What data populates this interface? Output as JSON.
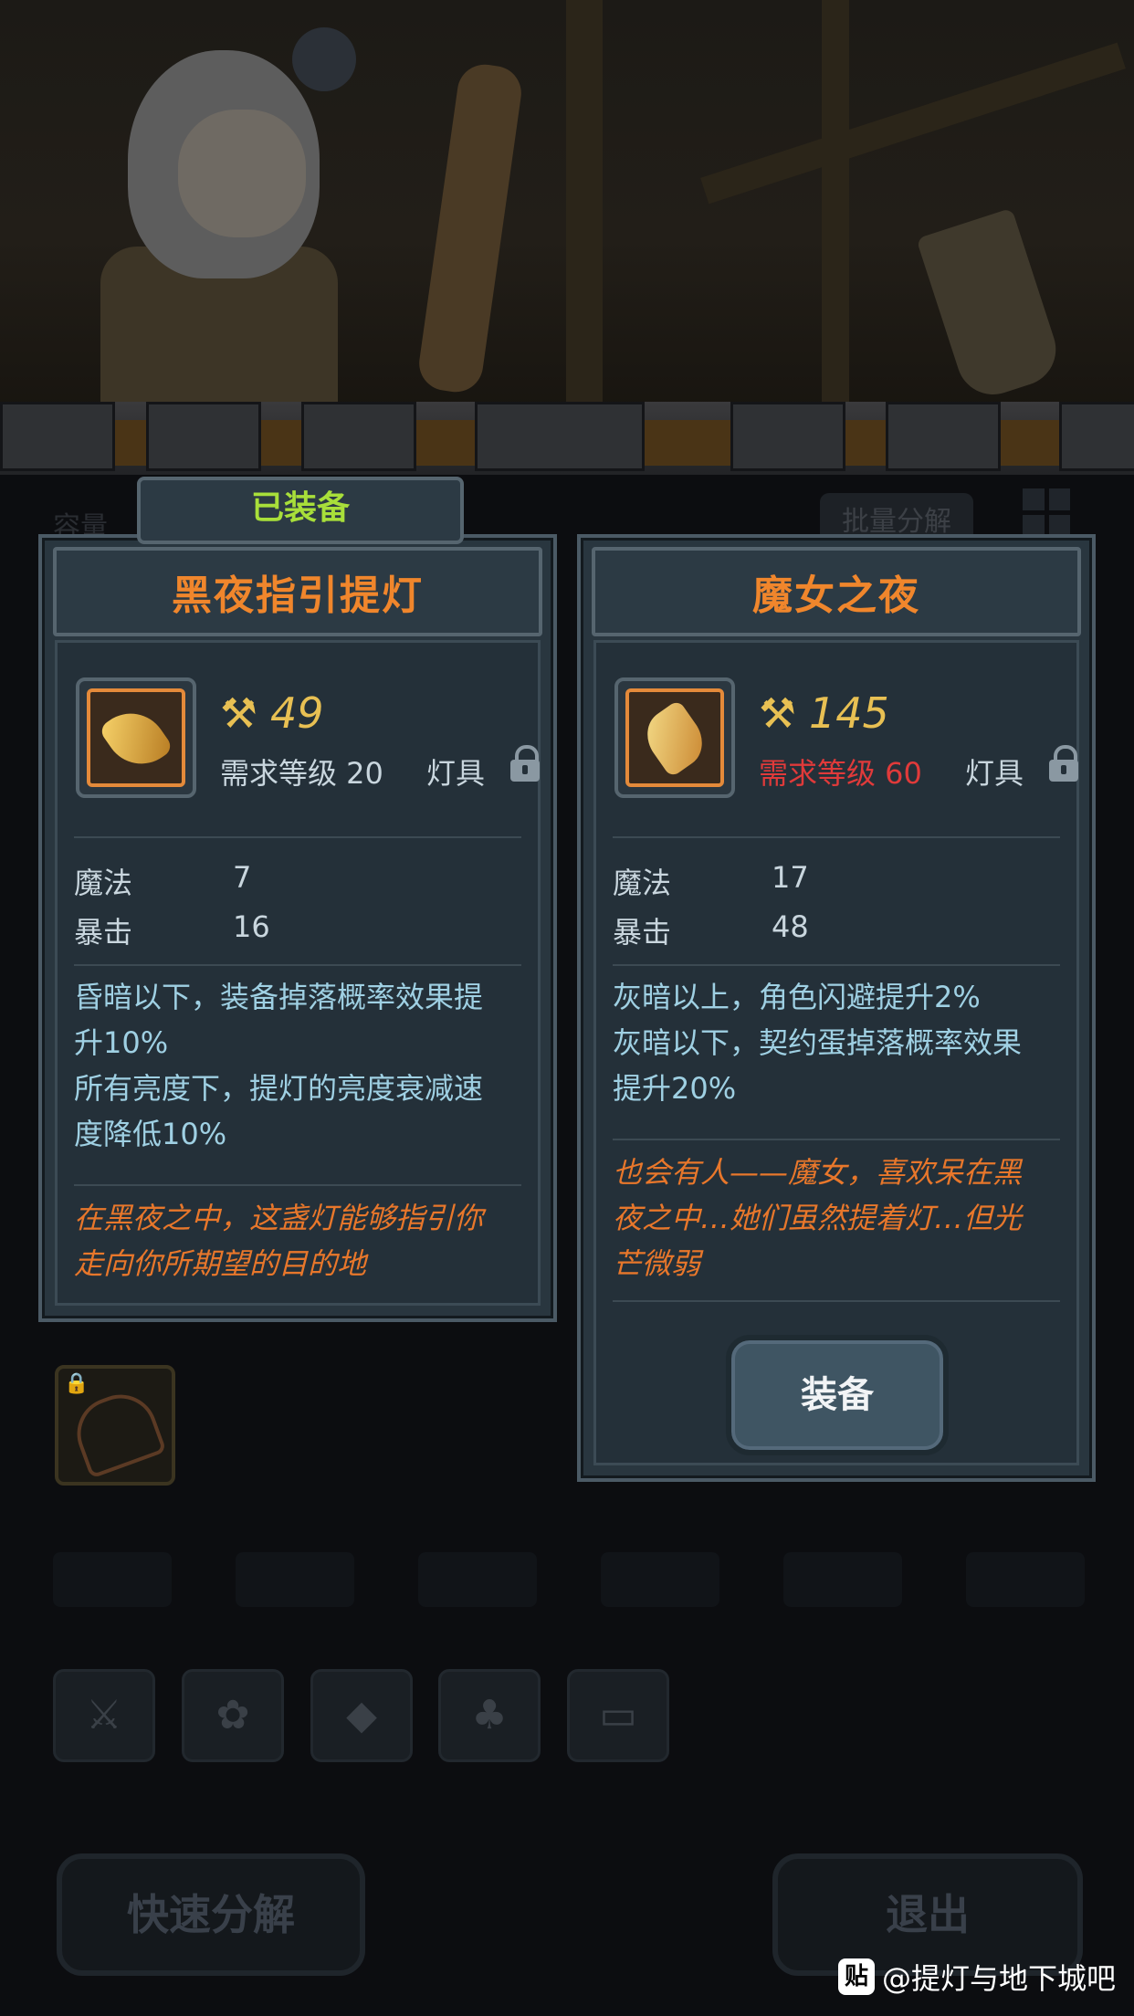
{
  "header": {
    "equipped_tag": "已装备",
    "capacity_label": "容量",
    "batch_decompose_label": "批量分解"
  },
  "equipped_item": {
    "name": "黑夜指引提灯",
    "power": "49",
    "requirement": "需求等级 20",
    "type": "灯具",
    "stats": [
      {
        "name": "魔法",
        "value": "7"
      },
      {
        "name": "暴击",
        "value": "16"
      }
    ],
    "description": [
      "昏暗以下，装备掉落概率效果提",
      "升10%",
      "所有亮度下，提灯的亮度衰减速",
      "度降低10%"
    ],
    "flavor": [
      "在黑夜之中，这盏灯能够指引你",
      "走向你所期望的目的地"
    ],
    "icon": "lantern-gauntlet-icon"
  },
  "compare_item": {
    "name": "魔女之夜",
    "power": "145",
    "requirement": "需求等级 60",
    "requirement_met": false,
    "type": "灯具",
    "stats": [
      {
        "name": "魔法",
        "value": "17"
      },
      {
        "name": "暴击",
        "value": "48"
      }
    ],
    "description": [
      "灰暗以上，角色闪避提升2%",
      "灰暗以下，契约蛋掉落概率效果",
      "提升20%"
    ],
    "flavor": [
      "也会有人——魔女，喜欢呆在黑",
      "夜之中…她们虽然提着灯…但光",
      "芒微弱"
    ],
    "icon": "witch-lantern-icon",
    "equip_button": "装备"
  },
  "bottom": {
    "quick_decompose": "快速分解",
    "exit": "退出",
    "category_icons": [
      "weapon-icon",
      "paw-icon",
      "gem-icon",
      "leaf-icon",
      "chest-icon"
    ]
  },
  "watermark": "@提灯与地下城吧",
  "colors": {
    "title_orange": "#f0862c",
    "power_gold": "#e8c053",
    "requirement_red": "#e03a3a",
    "description_cyan": "#9fd0e3",
    "flavor_orange": "#e8772b",
    "equipped_green": "#a8df3a"
  }
}
